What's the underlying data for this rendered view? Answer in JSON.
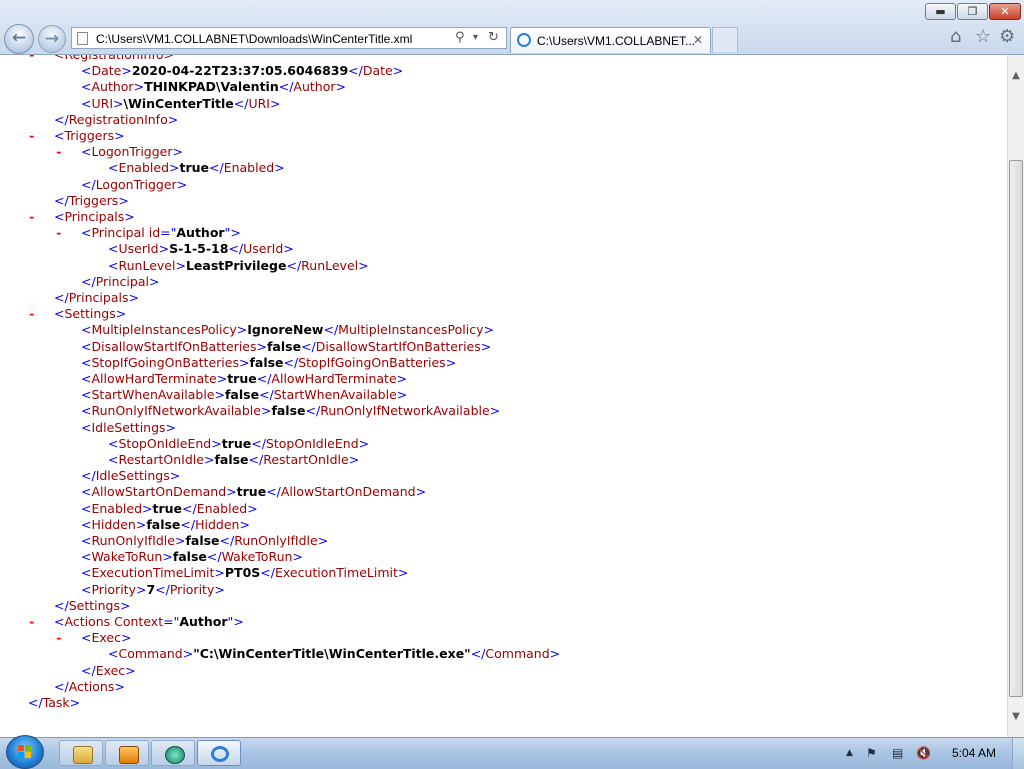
{
  "window": {
    "buttons": {
      "minimize": "▬",
      "maximize": "❐",
      "close": "✕"
    }
  },
  "toolbar": {
    "back_icon": "back-arrow-icon",
    "forward_icon": "forward-arrow-icon",
    "address_value": "C:\\Users\\VM1.COLLABNET\\Downloads\\WinCenterTitle.xml",
    "search_glyph": "⚲",
    "dropdown_glyph": "▾",
    "refresh_glyph": "↻",
    "tab_title": "C:\\Users\\VM1.COLLABNET...",
    "tab_close_glyph": "✕",
    "home_glyph": "⌂",
    "favorites_glyph": "☆",
    "tools_glyph": "⚙"
  },
  "xml_lines": [
    [
      {
        "c": "t",
        "s": "<RegistrationInfo>"
      }
    ],
    [
      {
        "c": "b",
        "s": "<"
      },
      {
        "c": "t",
        "s": "Date"
      },
      {
        "c": "b",
        "s": ">"
      },
      {
        "c": "v",
        "s": "2020-04-22T23:37:05.6046839"
      },
      {
        "c": "b",
        "s": "</"
      },
      {
        "c": "t",
        "s": "Date"
      },
      {
        "c": "b",
        "s": ">"
      }
    ],
    [
      {
        "c": "b",
        "s": "<"
      },
      {
        "c": "t",
        "s": "Author"
      },
      {
        "c": "b",
        "s": ">"
      },
      {
        "c": "v",
        "s": "THINKPAD\\Valentin"
      },
      {
        "c": "b",
        "s": "</"
      },
      {
        "c": "t",
        "s": "Author"
      },
      {
        "c": "b",
        "s": ">"
      }
    ],
    [
      {
        "c": "b",
        "s": "<"
      },
      {
        "c": "t",
        "s": "URI"
      },
      {
        "c": "b",
        "s": ">"
      },
      {
        "c": "v",
        "s": "\\WinCenterTitle"
      },
      {
        "c": "b",
        "s": "</"
      },
      {
        "c": "t",
        "s": "URI"
      },
      {
        "c": "b",
        "s": ">"
      }
    ],
    [
      {
        "c": "b",
        "s": "</"
      },
      {
        "c": "t",
        "s": "RegistrationInfo"
      },
      {
        "c": "b",
        "s": ">"
      }
    ],
    [
      {
        "c": "b",
        "s": "<"
      },
      {
        "c": "t",
        "s": "Triggers"
      },
      {
        "c": "b",
        "s": ">"
      }
    ],
    [
      {
        "c": "b",
        "s": "<"
      },
      {
        "c": "t",
        "s": "LogonTrigger"
      },
      {
        "c": "b",
        "s": ">"
      }
    ],
    [
      {
        "c": "b",
        "s": "<"
      },
      {
        "c": "t",
        "s": "Enabled"
      },
      {
        "c": "b",
        "s": ">"
      },
      {
        "c": "v",
        "s": "true"
      },
      {
        "c": "b",
        "s": "</"
      },
      {
        "c": "t",
        "s": "Enabled"
      },
      {
        "c": "b",
        "s": ">"
      }
    ],
    [
      {
        "c": "b",
        "s": "</"
      },
      {
        "c": "t",
        "s": "LogonTrigger"
      },
      {
        "c": "b",
        "s": ">"
      }
    ],
    [
      {
        "c": "b",
        "s": "</"
      },
      {
        "c": "t",
        "s": "Triggers"
      },
      {
        "c": "b",
        "s": ">"
      }
    ],
    [
      {
        "c": "b",
        "s": "<"
      },
      {
        "c": "t",
        "s": "Principals"
      },
      {
        "c": "b",
        "s": ">"
      }
    ],
    [
      {
        "c": "b",
        "s": "<"
      },
      {
        "c": "t",
        "s": "Principal"
      },
      {
        "c": "t",
        "s": " id"
      },
      {
        "c": "b",
        "s": "=\""
      },
      {
        "c": "v",
        "s": "Author"
      },
      {
        "c": "b",
        "s": "\">"
      }
    ],
    [
      {
        "c": "b",
        "s": "<"
      },
      {
        "c": "t",
        "s": "UserId"
      },
      {
        "c": "b",
        "s": ">"
      },
      {
        "c": "v",
        "s": "S-1-5-18"
      },
      {
        "c": "b",
        "s": "</"
      },
      {
        "c": "t",
        "s": "UserId"
      },
      {
        "c": "b",
        "s": ">"
      }
    ],
    [
      {
        "c": "b",
        "s": "<"
      },
      {
        "c": "t",
        "s": "RunLevel"
      },
      {
        "c": "b",
        "s": ">"
      },
      {
        "c": "v",
        "s": "LeastPrivilege"
      },
      {
        "c": "b",
        "s": "</"
      },
      {
        "c": "t",
        "s": "RunLevel"
      },
      {
        "c": "b",
        "s": ">"
      }
    ],
    [
      {
        "c": "b",
        "s": "</"
      },
      {
        "c": "t",
        "s": "Principal"
      },
      {
        "c": "b",
        "s": ">"
      }
    ],
    [
      {
        "c": "b",
        "s": "</"
      },
      {
        "c": "t",
        "s": "Principals"
      },
      {
        "c": "b",
        "s": ">"
      }
    ],
    [
      {
        "c": "b",
        "s": "<"
      },
      {
        "c": "t",
        "s": "Settings"
      },
      {
        "c": "b",
        "s": ">"
      }
    ],
    [
      {
        "c": "b",
        "s": "<"
      },
      {
        "c": "t",
        "s": "MultipleInstancesPolicy"
      },
      {
        "c": "b",
        "s": ">"
      },
      {
        "c": "v",
        "s": "IgnoreNew"
      },
      {
        "c": "b",
        "s": "</"
      },
      {
        "c": "t",
        "s": "MultipleInstancesPolicy"
      },
      {
        "c": "b",
        "s": ">"
      }
    ],
    [
      {
        "c": "b",
        "s": "<"
      },
      {
        "c": "t",
        "s": "DisallowStartIfOnBatteries"
      },
      {
        "c": "b",
        "s": ">"
      },
      {
        "c": "v",
        "s": "false"
      },
      {
        "c": "b",
        "s": "</"
      },
      {
        "c": "t",
        "s": "DisallowStartIfOnBatteries"
      },
      {
        "c": "b",
        "s": ">"
      }
    ],
    [
      {
        "c": "b",
        "s": "<"
      },
      {
        "c": "t",
        "s": "StopIfGoingOnBatteries"
      },
      {
        "c": "b",
        "s": ">"
      },
      {
        "c": "v",
        "s": "false"
      },
      {
        "c": "b",
        "s": "</"
      },
      {
        "c": "t",
        "s": "StopIfGoingOnBatteries"
      },
      {
        "c": "b",
        "s": ">"
      }
    ],
    [
      {
        "c": "b",
        "s": "<"
      },
      {
        "c": "t",
        "s": "AllowHardTerminate"
      },
      {
        "c": "b",
        "s": ">"
      },
      {
        "c": "v",
        "s": "true"
      },
      {
        "c": "b",
        "s": "</"
      },
      {
        "c": "t",
        "s": "AllowHardTerminate"
      },
      {
        "c": "b",
        "s": ">"
      }
    ],
    [
      {
        "c": "b",
        "s": "<"
      },
      {
        "c": "t",
        "s": "StartWhenAvailable"
      },
      {
        "c": "b",
        "s": ">"
      },
      {
        "c": "v",
        "s": "false"
      },
      {
        "c": "b",
        "s": "</"
      },
      {
        "c": "t",
        "s": "StartWhenAvailable"
      },
      {
        "c": "b",
        "s": ">"
      }
    ],
    [
      {
        "c": "b",
        "s": "<"
      },
      {
        "c": "t",
        "s": "RunOnlyIfNetworkAvailable"
      },
      {
        "c": "b",
        "s": ">"
      },
      {
        "c": "v",
        "s": "false"
      },
      {
        "c": "b",
        "s": "</"
      },
      {
        "c": "t",
        "s": "RunOnlyIfNetworkAvailable"
      },
      {
        "c": "b",
        "s": ">"
      }
    ],
    [
      {
        "c": "b",
        "s": "<"
      },
      {
        "c": "t",
        "s": "IdleSettings"
      },
      {
        "c": "b",
        "s": ">"
      }
    ],
    [
      {
        "c": "b",
        "s": "<"
      },
      {
        "c": "t",
        "s": "StopOnIdleEnd"
      },
      {
        "c": "b",
        "s": ">"
      },
      {
        "c": "v",
        "s": "true"
      },
      {
        "c": "b",
        "s": "</"
      },
      {
        "c": "t",
        "s": "StopOnIdleEnd"
      },
      {
        "c": "b",
        "s": ">"
      }
    ],
    [
      {
        "c": "b",
        "s": "<"
      },
      {
        "c": "t",
        "s": "RestartOnIdle"
      },
      {
        "c": "b",
        "s": ">"
      },
      {
        "c": "v",
        "s": "false"
      },
      {
        "c": "b",
        "s": "</"
      },
      {
        "c": "t",
        "s": "RestartOnIdle"
      },
      {
        "c": "b",
        "s": ">"
      }
    ],
    [
      {
        "c": "b",
        "s": "</"
      },
      {
        "c": "t",
        "s": "IdleSettings"
      },
      {
        "c": "b",
        "s": ">"
      }
    ],
    [
      {
        "c": "b",
        "s": "<"
      },
      {
        "c": "t",
        "s": "AllowStartOnDemand"
      },
      {
        "c": "b",
        "s": ">"
      },
      {
        "c": "v",
        "s": "true"
      },
      {
        "c": "b",
        "s": "</"
      },
      {
        "c": "t",
        "s": "AllowStartOnDemand"
      },
      {
        "c": "b",
        "s": ">"
      }
    ],
    [
      {
        "c": "b",
        "s": "<"
      },
      {
        "c": "t",
        "s": "Enabled"
      },
      {
        "c": "b",
        "s": ">"
      },
      {
        "c": "v",
        "s": "true"
      },
      {
        "c": "b",
        "s": "</"
      },
      {
        "c": "t",
        "s": "Enabled"
      },
      {
        "c": "b",
        "s": ">"
      }
    ],
    [
      {
        "c": "b",
        "s": "<"
      },
      {
        "c": "t",
        "s": "Hidden"
      },
      {
        "c": "b",
        "s": ">"
      },
      {
        "c": "v",
        "s": "false"
      },
      {
        "c": "b",
        "s": "</"
      },
      {
        "c": "t",
        "s": "Hidden"
      },
      {
        "c": "b",
        "s": ">"
      }
    ],
    [
      {
        "c": "b",
        "s": "<"
      },
      {
        "c": "t",
        "s": "RunOnlyIfIdle"
      },
      {
        "c": "b",
        "s": ">"
      },
      {
        "c": "v",
        "s": "false"
      },
      {
        "c": "b",
        "s": "</"
      },
      {
        "c": "t",
        "s": "RunOnlyIfIdle"
      },
      {
        "c": "b",
        "s": ">"
      }
    ],
    [
      {
        "c": "b",
        "s": "<"
      },
      {
        "c": "t",
        "s": "WakeToRun"
      },
      {
        "c": "b",
        "s": ">"
      },
      {
        "c": "v",
        "s": "false"
      },
      {
        "c": "b",
        "s": "</"
      },
      {
        "c": "t",
        "s": "WakeToRun"
      },
      {
        "c": "b",
        "s": ">"
      }
    ],
    [
      {
        "c": "b",
        "s": "<"
      },
      {
        "c": "t",
        "s": "ExecutionTimeLimit"
      },
      {
        "c": "b",
        "s": ">"
      },
      {
        "c": "v",
        "s": "PT0S"
      },
      {
        "c": "b",
        "s": "</"
      },
      {
        "c": "t",
        "s": "ExecutionTimeLimit"
      },
      {
        "c": "b",
        "s": ">"
      }
    ],
    [
      {
        "c": "b",
        "s": "<"
      },
      {
        "c": "t",
        "s": "Priority"
      },
      {
        "c": "b",
        "s": ">"
      },
      {
        "c": "v",
        "s": "7"
      },
      {
        "c": "b",
        "s": "</"
      },
      {
        "c": "t",
        "s": "Priority"
      },
      {
        "c": "b",
        "s": ">"
      }
    ],
    [
      {
        "c": "b",
        "s": "</"
      },
      {
        "c": "t",
        "s": "Settings"
      },
      {
        "c": "b",
        "s": ">"
      }
    ],
    [
      {
        "c": "b",
        "s": "<"
      },
      {
        "c": "t",
        "s": "Actions"
      },
      {
        "c": "t",
        "s": " Context"
      },
      {
        "c": "b",
        "s": "=\""
      },
      {
        "c": "v",
        "s": "Author"
      },
      {
        "c": "b",
        "s": "\">"
      }
    ],
    [
      {
        "c": "b",
        "s": "<"
      },
      {
        "c": "t",
        "s": "Exec"
      },
      {
        "c": "b",
        "s": ">"
      }
    ],
    [
      {
        "c": "b",
        "s": "<"
      },
      {
        "c": "t",
        "s": "Command"
      },
      {
        "c": "b",
        "s": ">"
      },
      {
        "c": "v",
        "s": "\"C:\\WinCenterTitle\\WinCenterTitle.exe\""
      },
      {
        "c": "b",
        "s": "</"
      },
      {
        "c": "t",
        "s": "Command"
      },
      {
        "c": "b",
        "s": ">"
      }
    ],
    [
      {
        "c": "b",
        "s": "</"
      },
      {
        "c": "t",
        "s": "Exec"
      },
      {
        "c": "b",
        "s": ">"
      }
    ],
    [
      {
        "c": "b",
        "s": "</"
      },
      {
        "c": "t",
        "s": "Actions"
      },
      {
        "c": "b",
        "s": ">"
      }
    ],
    [
      {
        "c": "b",
        "s": "</"
      },
      {
        "c": "t",
        "s": "Task"
      },
      {
        "c": "b",
        "s": ">"
      }
    ]
  ],
  "collapse_marker": "-",
  "scroll": {
    "position": 0.12,
    "visible_fraction": 0.88
  },
  "taskbar": {
    "start_icon": "windows-start-icon",
    "pinned": [
      "explorer-icon",
      "media-player-icon",
      "media-center-icon",
      "internet-explorer-icon"
    ],
    "tray_arrow": "▲",
    "clock": "5:04 AM"
  },
  "colors": {
    "tag": "#990000",
    "markup": "#0000ff",
    "value": "#000000",
    "collapse": "#ff0000"
  }
}
